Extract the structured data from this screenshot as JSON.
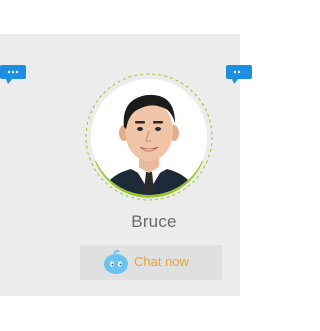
{
  "profile": {
    "name": "Bruce"
  },
  "chat_button": {
    "label": "Chat now",
    "icon": "chat-bubble-mascot-icon"
  },
  "side_controls": {
    "left_icon": "chat-bubble-icon",
    "right_icon": "chat-bubble-icon"
  },
  "colors": {
    "card_background": "#ececec",
    "accent_green": "#9ac62a",
    "button_background": "#e0e0e0",
    "chat_label": "#f2a12b",
    "side_icon": "#1c8fe0"
  }
}
